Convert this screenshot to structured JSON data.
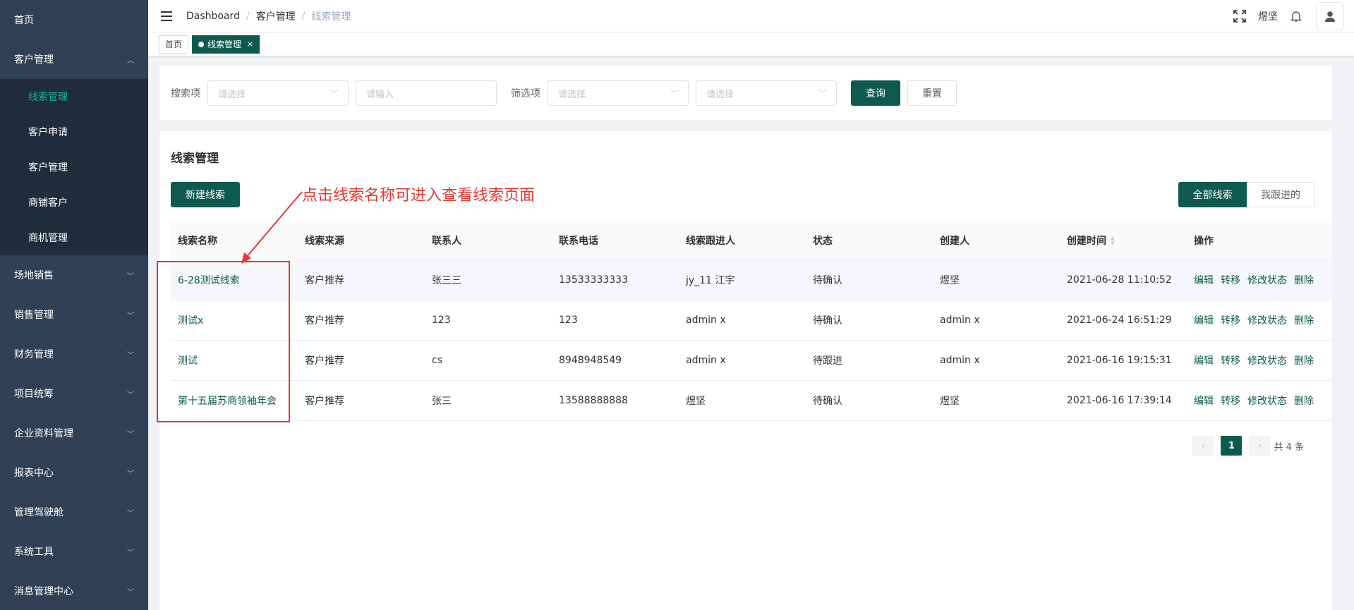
{
  "sidebar": {
    "items": [
      {
        "label": "首页"
      },
      {
        "label": "客户管理",
        "open": true,
        "children": [
          {
            "label": "线索管理",
            "active": true
          },
          {
            "label": "客户申请"
          },
          {
            "label": "客户管理"
          },
          {
            "label": "商铺客户"
          },
          {
            "label": "商机管理"
          }
        ]
      },
      {
        "label": "场地销售"
      },
      {
        "label": "销售管理"
      },
      {
        "label": "财务管理"
      },
      {
        "label": "项目统筹"
      },
      {
        "label": "企业资料管理"
      },
      {
        "label": "报表中心"
      },
      {
        "label": "管理驾驶舱"
      },
      {
        "label": "系统工具"
      },
      {
        "label": "消息管理中心"
      }
    ]
  },
  "header": {
    "breadcrumb": [
      "Dashboard",
      "客户管理",
      "线索管理"
    ],
    "username": "煜坚",
    "icons": [
      "fullscreen-icon",
      "bell-icon",
      "user-icon"
    ]
  },
  "tags": [
    {
      "label": "首页"
    },
    {
      "label": "线索管理",
      "close": "×"
    }
  ],
  "search": {
    "search_label": "搜索项",
    "search_select_placeholder": "请选择",
    "search_input_placeholder": "请输入",
    "filter_label": "筛选项",
    "filter_select1_placeholder": "请选择",
    "filter_select2_placeholder": "请选择",
    "query_button": "查询",
    "reset_button": "重置"
  },
  "main": {
    "title": "线索管理",
    "new_button": "新建线索",
    "segment": [
      "全部线索",
      "我跟进的"
    ],
    "columns": [
      "线索名称",
      "线索来源",
      "联系人",
      "联系电话",
      "线索跟进人",
      "状态",
      "创建人",
      "创建时间",
      "操作"
    ],
    "rows": [
      {
        "name": "6-28测试线索",
        "source": "客户推荐",
        "contact": "张三三",
        "phone": "13533333333",
        "follower": "jy_11 江宇",
        "status": "待确认",
        "creator": "煜坚",
        "created": "2021-06-28 11:10:52"
      },
      {
        "name": "测试x",
        "source": "客户推荐",
        "contact": "123",
        "phone": "123",
        "follower": "admin x",
        "status": "待确认",
        "creator": "admin x",
        "created": "2021-06-24 16:51:29"
      },
      {
        "name": "测试",
        "source": "客户推荐",
        "contact": "cs",
        "phone": "8948948549",
        "follower": "admin x",
        "status": "待跟进",
        "creator": "admin x",
        "created": "2021-06-16 19:15:31"
      },
      {
        "name": "第十五届苏商领袖年会",
        "source": "客户推荐",
        "contact": "张三",
        "phone": "13588888888",
        "follower": "煜坚",
        "status": "待确认",
        "creator": "煜坚",
        "created": "2021-06-16 17:39:14"
      }
    ],
    "ops": [
      "编辑",
      "转移",
      "修改状态",
      "删除"
    ],
    "pagination": {
      "current": "1",
      "total": "共 4 条"
    }
  },
  "annotation": {
    "text": "点击线索名称可进入查看线索页面",
    "color": "#e53935"
  },
  "colors": {
    "sidebar": "#304156",
    "submenu": "#1f2d3d",
    "primary": "#0f5a4f",
    "active_menu": "#1fb39a"
  }
}
